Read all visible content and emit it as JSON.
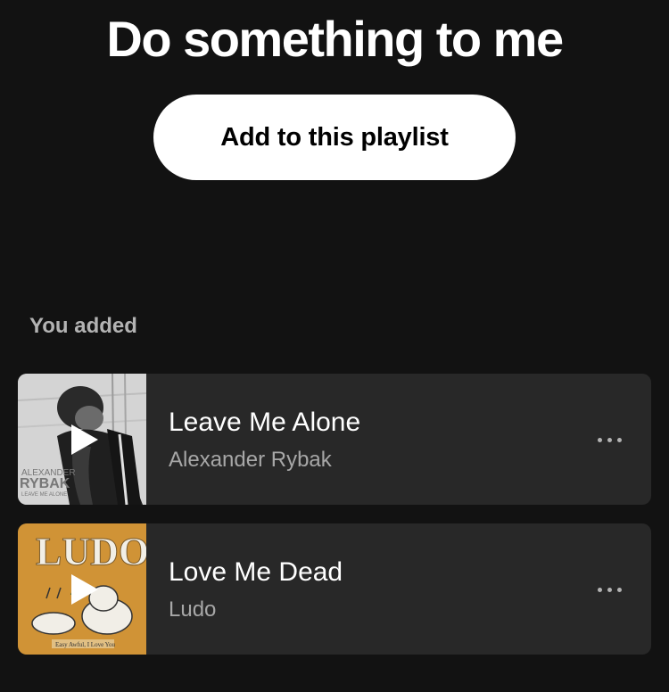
{
  "playlist": {
    "title": "Do something to me",
    "add_button_label": "Add to this playlist"
  },
  "section": {
    "label": "You added"
  },
  "tracks": [
    {
      "title": "Leave Me Alone",
      "artist": "Alexander Rybak",
      "cover_text": [
        "ALEXANDER",
        "RYBAK",
        "LEAVE ME ALONE"
      ],
      "cover_icon": "play-icon",
      "more_icon": "more-options-icon"
    },
    {
      "title": "Love Me Dead",
      "artist": "Ludo",
      "cover_text": [
        "LUDO",
        "Easy Awful, I Love You"
      ],
      "cover_icon": "play-icon",
      "more_icon": "more-options-icon"
    }
  ],
  "colors": {
    "background": "#121212",
    "card": "#282828",
    "button_bg": "#ffffff",
    "secondary_text": "#a7a7a7"
  }
}
